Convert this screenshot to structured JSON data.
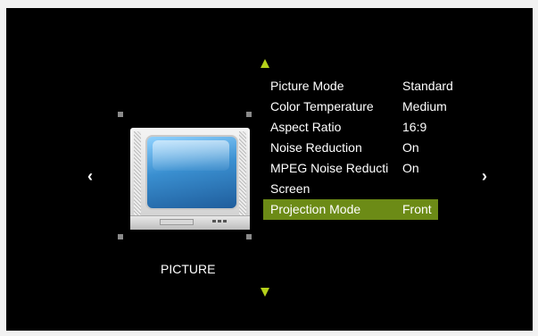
{
  "section_label": "PICTURE",
  "nav": {
    "left_arrow": "‹",
    "right_arrow": "›"
  },
  "menu": {
    "items": [
      {
        "label": "Picture Mode",
        "value": "Standard"
      },
      {
        "label": "Color Temperature",
        "value": "Medium"
      },
      {
        "label": "Aspect Ratio",
        "value": "16:9"
      },
      {
        "label": "Noise Reduction",
        "value": "On"
      },
      {
        "label": "MPEG  Noise Reducti",
        "value": "On"
      },
      {
        "label": "Screen",
        "value": ""
      },
      {
        "label": "Projection Mode",
        "value": "Front"
      }
    ],
    "selected_index": 6
  },
  "colors": {
    "accent": "#b5d11a",
    "selected_row": "#6c8b16",
    "background": "#000000"
  }
}
